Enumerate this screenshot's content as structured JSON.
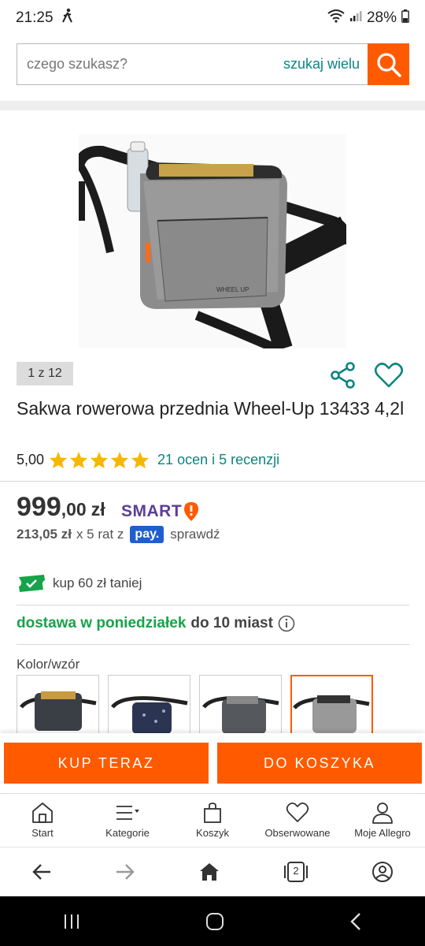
{
  "status_bar": {
    "time": "21:25",
    "battery": "28%"
  },
  "search": {
    "placeholder": "czego szukasz?",
    "multi_label": "szukaj wielu"
  },
  "gallery": {
    "counter": "1 z 12"
  },
  "product": {
    "title": "Sakwa rowerowa przednia Wheel-Up 13433 4,2l",
    "rating_value": "5,00",
    "rating_stars": 5,
    "rating_link": "21 ocen i 5 recenzji"
  },
  "price": {
    "main": "999",
    "decimal": ",00",
    "currency": "zł",
    "smart_label": "SMART",
    "installment_amount": "213,05 zł",
    "installment_text": "x 5 rat z",
    "pay_label": "pay.",
    "check_label": "sprawdź"
  },
  "coupon": {
    "text": "kup 60 zł taniej"
  },
  "delivery": {
    "bold": "dostawa w poniedziałek",
    "rest": "do 10 miast"
  },
  "variants": {
    "label": "Kolor/wzór",
    "count": 4,
    "selected_index": 3
  },
  "cta": {
    "buy_label": "KUP TERAZ",
    "cart_label": "DO KOSZYKA"
  },
  "nav": {
    "items": [
      {
        "label": "Start",
        "icon": "home-icon"
      },
      {
        "label": "Kategorie",
        "icon": "menu-icon"
      },
      {
        "label": "Koszyk",
        "icon": "cart-icon"
      },
      {
        "label": "Obserwowane",
        "icon": "heart-icon"
      },
      {
        "label": "Moje Allegro",
        "icon": "user-icon"
      }
    ]
  },
  "browser": {
    "tabs_count": "2"
  },
  "colors": {
    "accent": "#ff5a00",
    "link": "#0b8580",
    "smart": "#5d3d96",
    "delivery": "#16a34a",
    "pay": "#1f5fcc"
  }
}
